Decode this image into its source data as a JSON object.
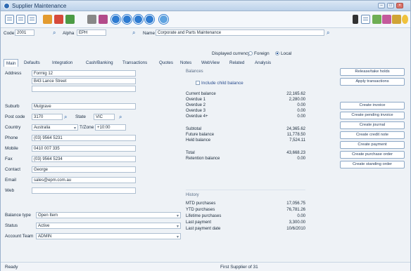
{
  "window": {
    "title": "Supplier Maintenance"
  },
  "topfields": {
    "code_label": "Code",
    "code_value": "2001",
    "alpha_label": "Alpha",
    "alpha_value": "EPH",
    "name_label": "Name",
    "name_value": "Corporate and Parts Maintenance"
  },
  "currency": {
    "label": "Displayed currency",
    "opt1": "Foreign",
    "opt2": "Local",
    "selected": "Local"
  },
  "tabs": [
    "Main",
    "Defaults",
    "Integration",
    "Cash/Banking",
    "Transactions",
    "Quotes",
    "Notes",
    "WebView",
    "Related",
    "Analysis"
  ],
  "form": {
    "address_label": "Address",
    "address1": "Formig 12",
    "address2": "B43 Lance Street",
    "address3": "",
    "suburb_label": "Suburb",
    "suburb": "Mulgrave",
    "postcode_label": "Post code",
    "postcode": "3170",
    "state_label": "State",
    "state": "VIC",
    "country_label": "Country",
    "country": "Australia",
    "tzone_label": "T/Zone",
    "tzone": "+10:00",
    "phone_label": "Phone",
    "phone": "(03) 9564 5231",
    "mobile_label": "Mobile",
    "mobile": "0410 007 335",
    "fax_label": "Fax",
    "fax": "(03) 9564 5234",
    "contact_label": "Contact",
    "contact": "George",
    "email_label": "Email",
    "email": "sales@epm.com.au",
    "web_label": "Web",
    "web": "",
    "balance_label": "Balance type",
    "balance": "Open Item",
    "status_label": "Status",
    "status": "Active",
    "account_label": "Account Team",
    "account": "ADMIN"
  },
  "balances": {
    "heading": "Balances",
    "include_label": "Include child balance",
    "rows": [
      {
        "k": "Current balance",
        "v": "22,165.62"
      },
      {
        "k": "Overdue 1",
        "v": "2,280.00"
      },
      {
        "k": "Overdue 2",
        "v": "0.00"
      },
      {
        "k": "Overdue 3",
        "v": "0.00"
      },
      {
        "k": "Overdue 4+",
        "v": "0.00"
      }
    ],
    "rows2": [
      {
        "k": "Subtotal",
        "v": "24,365.62"
      },
      {
        "k": "Future balance",
        "v": "11,778.50"
      },
      {
        "k": "Held balance",
        "v": "7,524.11"
      }
    ],
    "rows3": [
      {
        "k": "Total",
        "v": "43,668.23"
      },
      {
        "k": "Retention balance",
        "v": "0.00"
      }
    ]
  },
  "history": {
    "heading": "History",
    "rows": [
      {
        "k": "MTD purchases",
        "v": "17,056.75"
      },
      {
        "k": "YTD purchases",
        "v": "76,781.26"
      },
      {
        "k": "Lifetime purchases",
        "v": "0.00"
      },
      {
        "k": "Last payment",
        "v": "3,300.00"
      },
      {
        "k": "Last payment date",
        "v": "10/6/2010"
      }
    ]
  },
  "sidebuttons": [
    "Release/take holds",
    "Apply transactions",
    "Create invoice",
    "Create pending invoice",
    "Create journal",
    "Create credit note",
    "Create payment",
    "Create purchase order",
    "Create standing order"
  ],
  "statusbar": {
    "left": "Ready",
    "center": "First Supplier of 31"
  }
}
